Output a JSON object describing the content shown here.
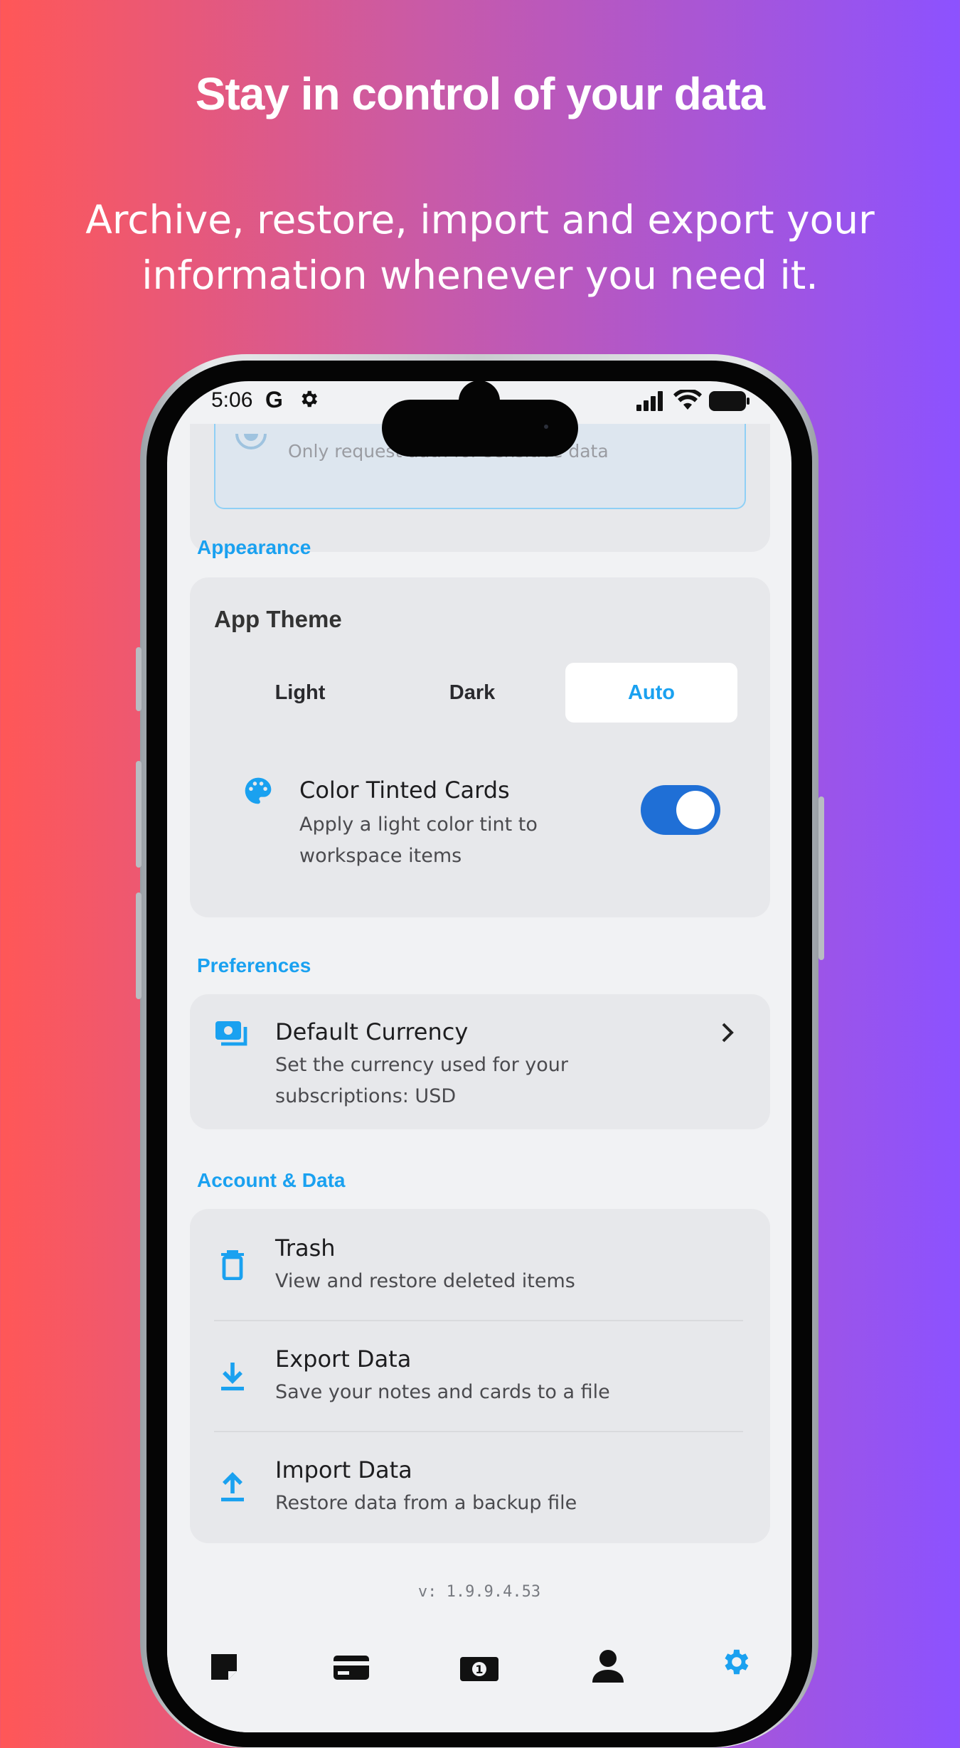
{
  "marketing": {
    "headline": "Stay in control of your data",
    "subline_1": "Archive, restore, import and export your",
    "subline_2": "information whenever you need it."
  },
  "status_bar": {
    "time": "5:06",
    "google_letter": "G"
  },
  "top_card": {
    "partial_text": "Only request auth for sensitive data"
  },
  "appearance": {
    "section_label": "Appearance",
    "app_theme_label": "App Theme",
    "theme_options": [
      "Light",
      "Dark",
      "Auto"
    ],
    "selected_theme": "Auto",
    "tinted_cards": {
      "title": "Color Tinted Cards",
      "desc_1": "Apply a light color tint to",
      "desc_2": "workspace items",
      "enabled": true,
      "icon": "palette-icon"
    }
  },
  "preferences": {
    "section_label": "Preferences",
    "currency": {
      "title": "Default Currency",
      "desc_1": "Set the currency used for your",
      "desc_2": "subscriptions: USD",
      "icon": "currency-icon"
    }
  },
  "account_data": {
    "section_label": "Account & Data",
    "items": [
      {
        "title": "Trash",
        "desc": "View and restore deleted items",
        "icon": "trash-icon"
      },
      {
        "title": "Export Data",
        "desc": "Save your notes and cards to a file",
        "icon": "download-icon"
      },
      {
        "title": "Import Data",
        "desc": "Restore data from a backup file",
        "icon": "upload-icon"
      }
    ]
  },
  "version": "v: 1.9.9.4.53",
  "bottom_nav": [
    "notes-icon",
    "card-icon",
    "money-icon",
    "profile-icon",
    "settings-icon"
  ],
  "colors": {
    "accent": "#1aa1f0",
    "toggle": "#1f6fd6"
  }
}
